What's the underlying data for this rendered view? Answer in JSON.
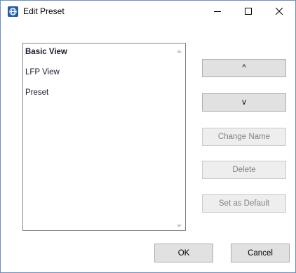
{
  "window": {
    "title": "Edit Preset",
    "icon": "app-globe-icon",
    "accent_color": "#1e5fa8"
  },
  "presets": {
    "items": [
      {
        "label": "Basic View",
        "bold": true
      },
      {
        "label": "LFP View",
        "bold": false
      },
      {
        "label": "Preset",
        "bold": false
      }
    ]
  },
  "side_buttons": {
    "move_up": "^",
    "move_down": "v",
    "change_name": "Change Name",
    "delete": "Delete",
    "set_default": "Set as Default"
  },
  "footer": {
    "ok": "OK",
    "cancel": "Cancel"
  }
}
